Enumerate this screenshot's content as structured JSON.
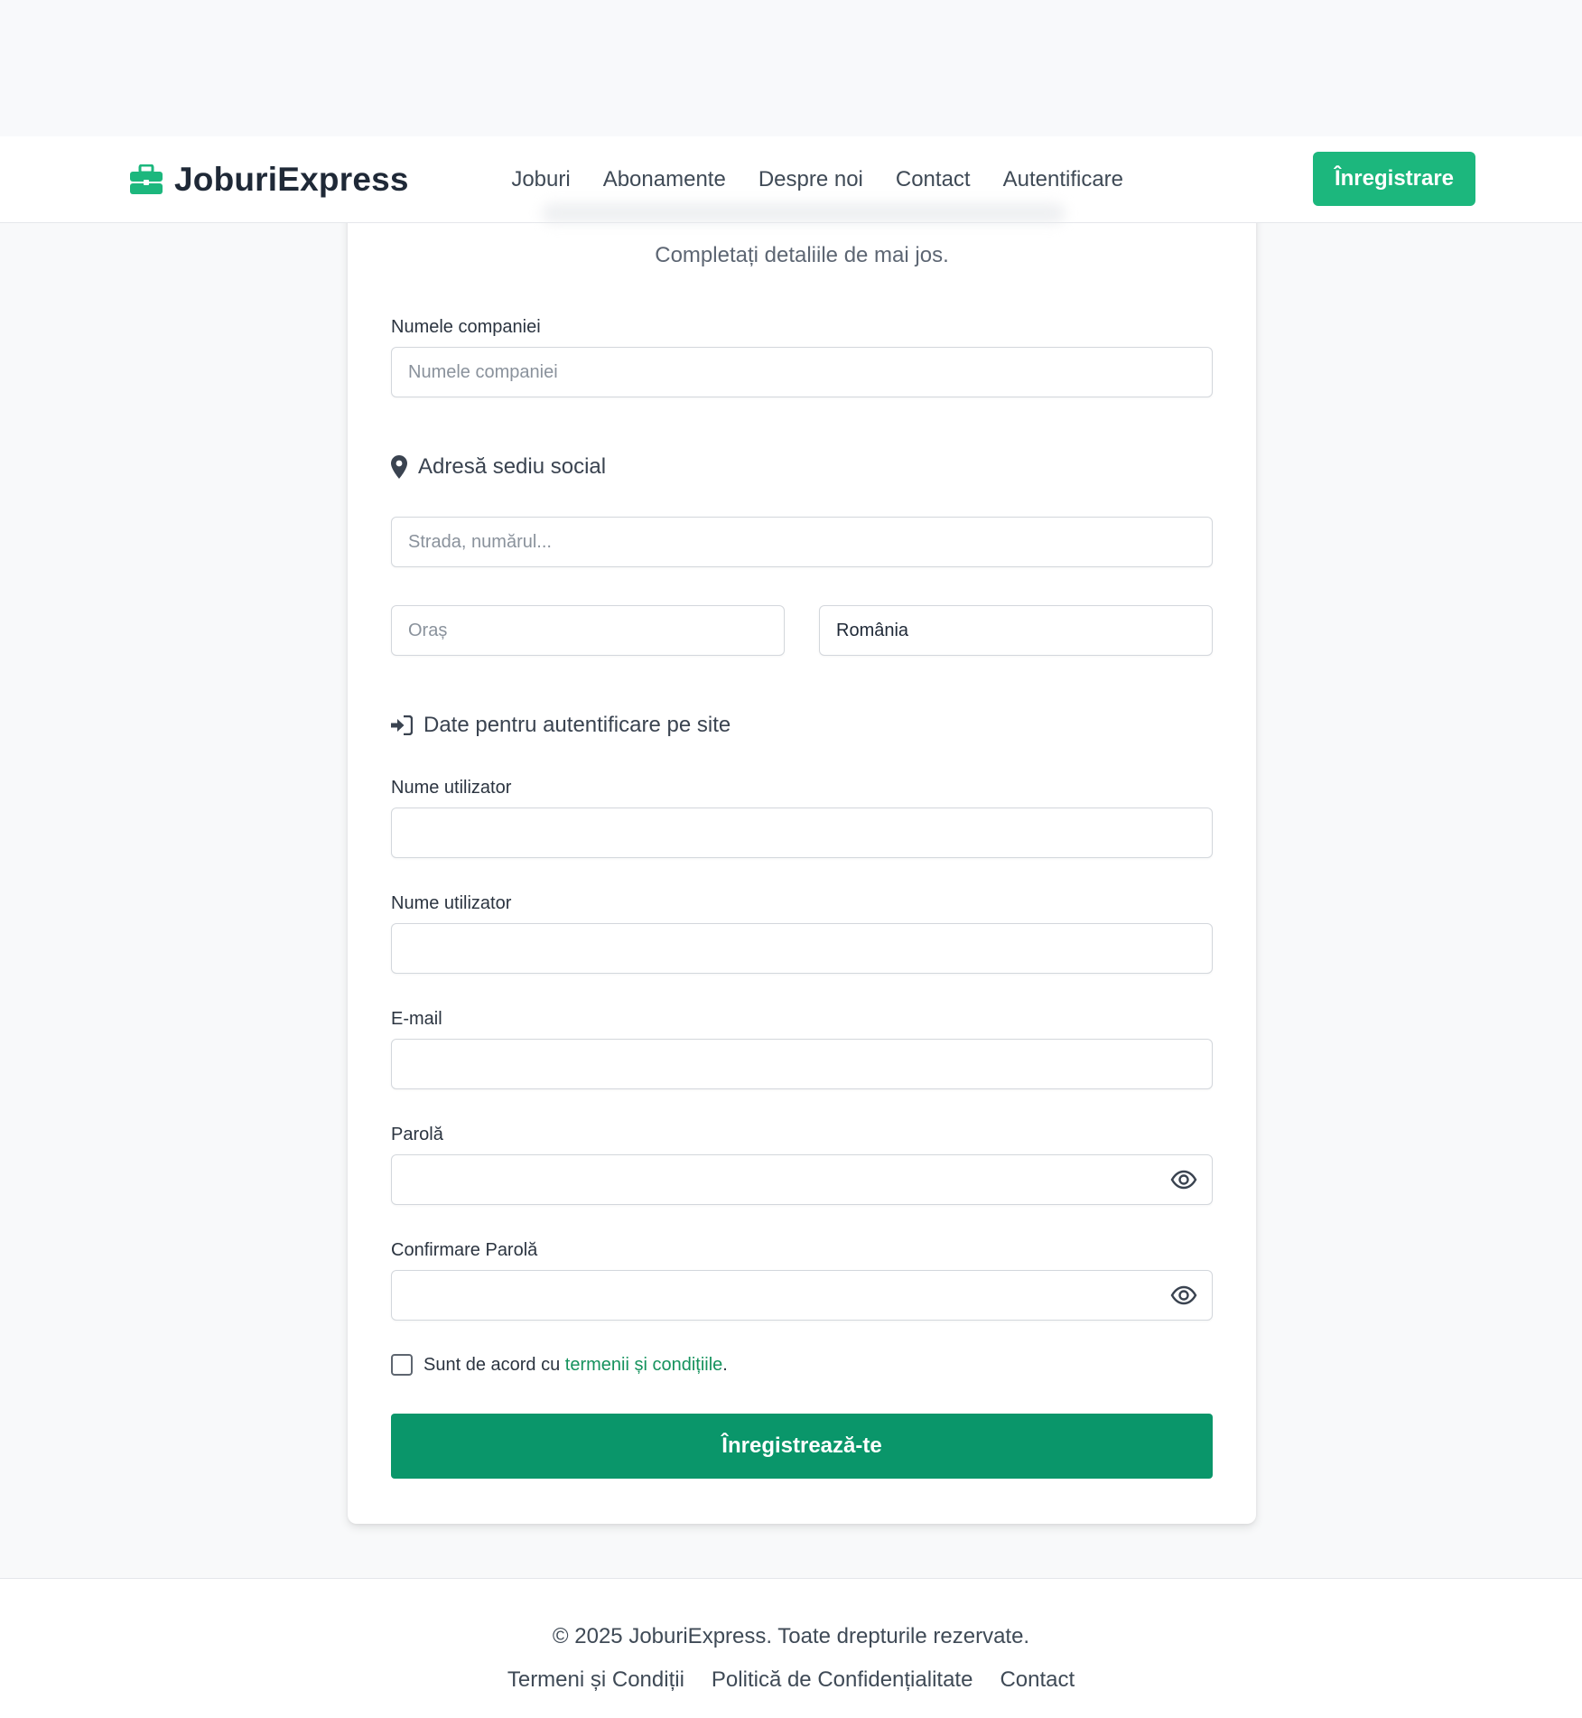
{
  "brand": {
    "name": "JoburiExpress",
    "icon": "briefcase-icon",
    "color": "#1cb77d"
  },
  "nav": {
    "links": [
      "Joburi",
      "Abonamente",
      "Despre noi",
      "Contact",
      "Autentificare"
    ],
    "cta": "Înregistrare"
  },
  "form": {
    "subtitle": "Completați detaliile de mai jos.",
    "company": {
      "label": "Numele companiei",
      "placeholder": "Numele companiei"
    },
    "address_section": {
      "title": "Adresă sediu social",
      "icon": "map-marker-icon"
    },
    "street": {
      "placeholder": "Strada, numărul..."
    },
    "city": {
      "placeholder": "Oraș"
    },
    "country": {
      "value": "România"
    },
    "login_section": {
      "title": "Date pentru autentificare pe site",
      "icon": "sign-in-icon"
    },
    "username1": {
      "label": "Nume utilizator",
      "value": ""
    },
    "username2": {
      "label": "Nume utilizator",
      "value": ""
    },
    "email": {
      "label": "E-mail",
      "value": ""
    },
    "password": {
      "label": "Parolă",
      "value": ""
    },
    "password_confirm": {
      "label": "Confirmare Parolă",
      "value": ""
    },
    "terms": {
      "prefix": "Sunt de acord cu ",
      "link": "termenii și condițiile",
      "suffix": ".",
      "checked": false
    },
    "submit": "Înregistrează-te"
  },
  "footer": {
    "copyright": "© 2025 JoburiExpress. Toate drepturile rezervate.",
    "links": [
      "Termeni și Condiții",
      "Politică de Confidențialitate",
      "Contact"
    ]
  },
  "colors": {
    "accent": "#1cb77d",
    "submit": "#0a966a",
    "link": "#15925d"
  }
}
